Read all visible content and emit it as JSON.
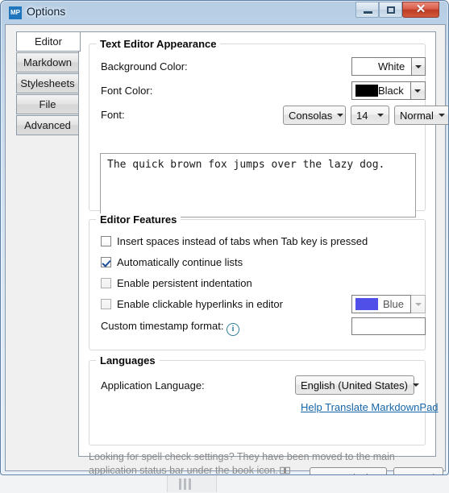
{
  "window": {
    "title": "Options",
    "app_icon_text": "MP",
    "controls": {
      "minimize": "minimize-icon",
      "maximize": "maximize-icon",
      "close": "✕"
    }
  },
  "tabs": [
    {
      "label": "Editor",
      "selected": true
    },
    {
      "label": "Markdown",
      "selected": false
    },
    {
      "label": "Stylesheets",
      "selected": false
    },
    {
      "label": "File",
      "selected": false
    },
    {
      "label": "Advanced",
      "selected": false
    }
  ],
  "appearance": {
    "group_title": "Text Editor Appearance",
    "background_color": {
      "label": "Background Color:",
      "value": "White",
      "swatch": "#ffffff"
    },
    "font_color": {
      "label": "Font Color:",
      "value": "Black",
      "swatch": "#000000"
    },
    "font": {
      "label": "Font:",
      "family": "Consolas",
      "size": "14",
      "style": "Normal"
    },
    "preview_text": "The quick brown fox jumps over the lazy dog."
  },
  "features": {
    "group_title": "Editor Features",
    "items": [
      {
        "label": "Insert spaces instead of tabs when Tab key is pressed",
        "checked": false,
        "enabled": true
      },
      {
        "label": "Automatically continue lists",
        "checked": true,
        "enabled": true
      },
      {
        "label": "Enable persistent indentation",
        "checked": false,
        "enabled": false
      },
      {
        "label": "Enable clickable hyperlinks in editor",
        "checked": false,
        "enabled": false
      }
    ],
    "hyperlink_color": {
      "value": "Blue",
      "swatch": "#5050e8",
      "enabled": false
    },
    "timestamp": {
      "label": "Custom timestamp format:",
      "info_glyph": "i",
      "value": "",
      "placeholder": ""
    }
  },
  "languages": {
    "group_title": "Languages",
    "app_language_label": "Application Language:",
    "app_language_value": "English (United States)",
    "translate_link": "Help Translate MarkdownPad",
    "hint_line1": "Looking for spell check settings? They have been moved to the main application",
    "hint_line2": "status bar under the book icon."
  },
  "footer": {
    "save_label": "Save and Close",
    "cancel_label": "Cancel"
  },
  "colors": {
    "accent": "#1f76bd",
    "link": "#1565a8",
    "close_button": "#bd3c22"
  }
}
